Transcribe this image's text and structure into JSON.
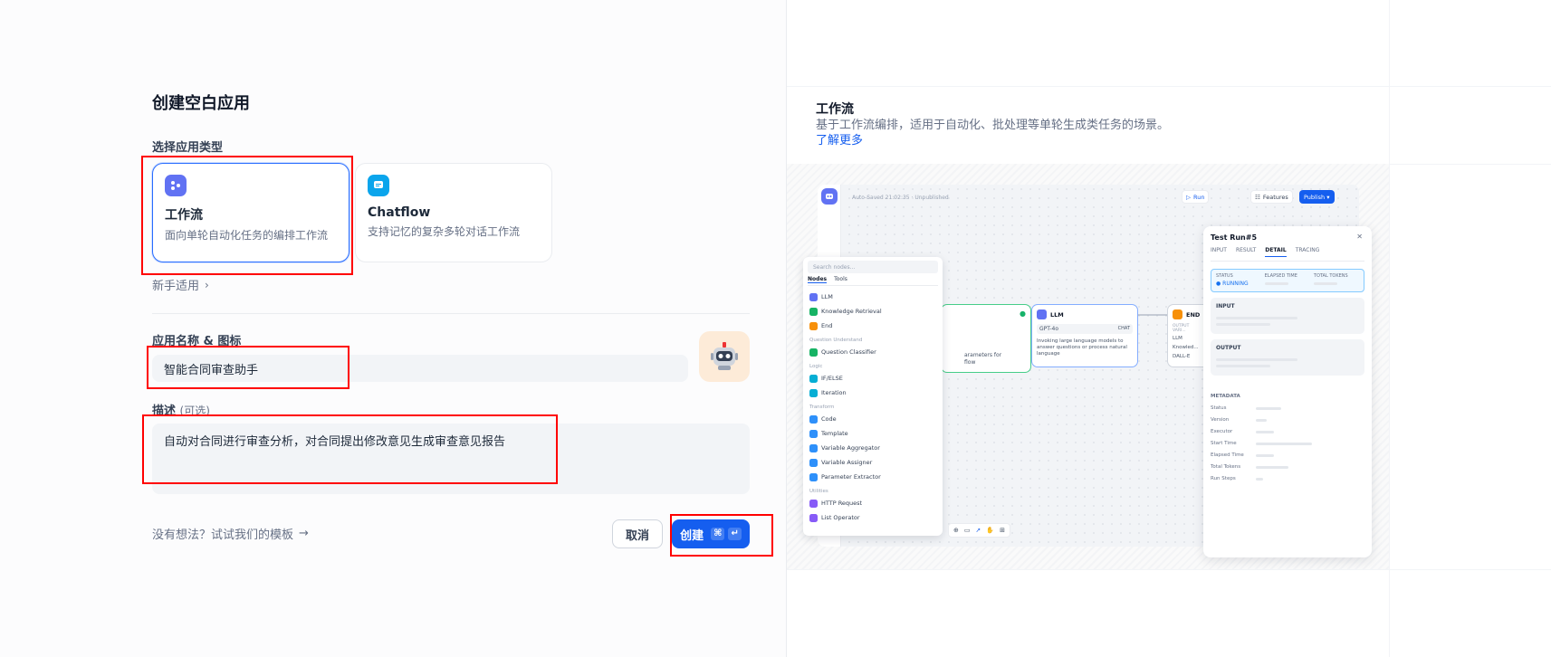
{
  "left": {
    "title": "创建空白应用",
    "type_label": "选择应用类型",
    "types": [
      {
        "name": "工作流",
        "desc": "面向单轮自动化任务的编排工作流",
        "icon": "workflow-icon",
        "color": "#6172f3"
      },
      {
        "name": "Chatflow",
        "desc": "支持记忆的复杂多轮对话工作流",
        "icon": "chatflow-icon",
        "color": "#0ba5ec"
      }
    ],
    "beginner_label": "新手适用",
    "name_label": "应用名称 & 图标",
    "name_value": "智能合同审查助手",
    "desc_label": "描述",
    "desc_optional": "(可选)",
    "desc_value": "自动对合同进行审查分析，对合同提出修改意见生成审查意见报告",
    "template_link": "没有想法？试试我们的模板",
    "cancel": "取消",
    "create": "创建",
    "create_kbd_1": "⌘",
    "create_kbd_2": "↵"
  },
  "right": {
    "title": "工作流",
    "desc": "基于工作流编排，适用于自动化、批处理等单轮生成类任务的场景。",
    "learn_more": "了解更多",
    "preview": {
      "status": "Auto-Saved 21:02:35 · Unpublished",
      "run": "Run",
      "features": "Features",
      "publish": "Publish",
      "search_placeholder": "Search nodes...",
      "tab_nodes": "Nodes",
      "tab_tools": "Tools",
      "menu": [
        {
          "group": "",
          "items": [
            "LLM",
            "Knowledge Retrieval",
            "End"
          ]
        },
        {
          "group": "Question Understand",
          "items": [
            "Question Classifier"
          ]
        },
        {
          "group": "Logic",
          "items": [
            "IF/ELSE",
            "Iteration"
          ]
        },
        {
          "group": "Transform",
          "items": [
            "Code",
            "Template",
            "Variable Aggregator",
            "Variable Assigner",
            "Parameter Extractor"
          ]
        },
        {
          "group": "Utilities",
          "items": [
            "HTTP Request",
            "List Operator"
          ]
        }
      ],
      "llm_node": {
        "title": "LLM",
        "model": "GPT-4o",
        "badge": "CHAT",
        "desc": "Invoking large language models to answer questions or process natural language"
      },
      "end_node": {
        "title": "END",
        "sub": "OUTPUT VARI...",
        "rows": [
          "LLM",
          "Knowled...",
          "DALL-E"
        ]
      },
      "start_node": {
        "desc_1": "arameters for",
        "desc_2": "flow"
      },
      "run_panel": {
        "title": "Test Run#5",
        "tabs": [
          "INPUT",
          "RESULT",
          "DETAIL",
          "TRACING"
        ],
        "status_label": "STATUS",
        "status_value": "RUNNING",
        "elapsed_label": "ELAPSED TIME",
        "tokens_label": "TOTAL TOKENS",
        "input_label": "INPUT",
        "output_label": "OUTPUT",
        "metadata_label": "METADATA",
        "meta_rows": [
          "Status",
          "Version",
          "Executor",
          "Start Time",
          "Elapsed Time",
          "Total Tokens",
          "Run Steps"
        ]
      }
    }
  }
}
